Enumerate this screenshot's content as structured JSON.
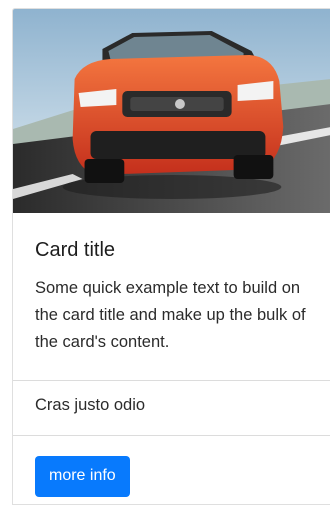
{
  "card": {
    "title": "Card title",
    "text": "Some quick example text to build on the card title and make up the bulk of the card's content.",
    "list_item": "Cras justo odio",
    "button_label": "more info"
  },
  "colors": {
    "button": "#087afd",
    "car_body": "#e8482a"
  }
}
